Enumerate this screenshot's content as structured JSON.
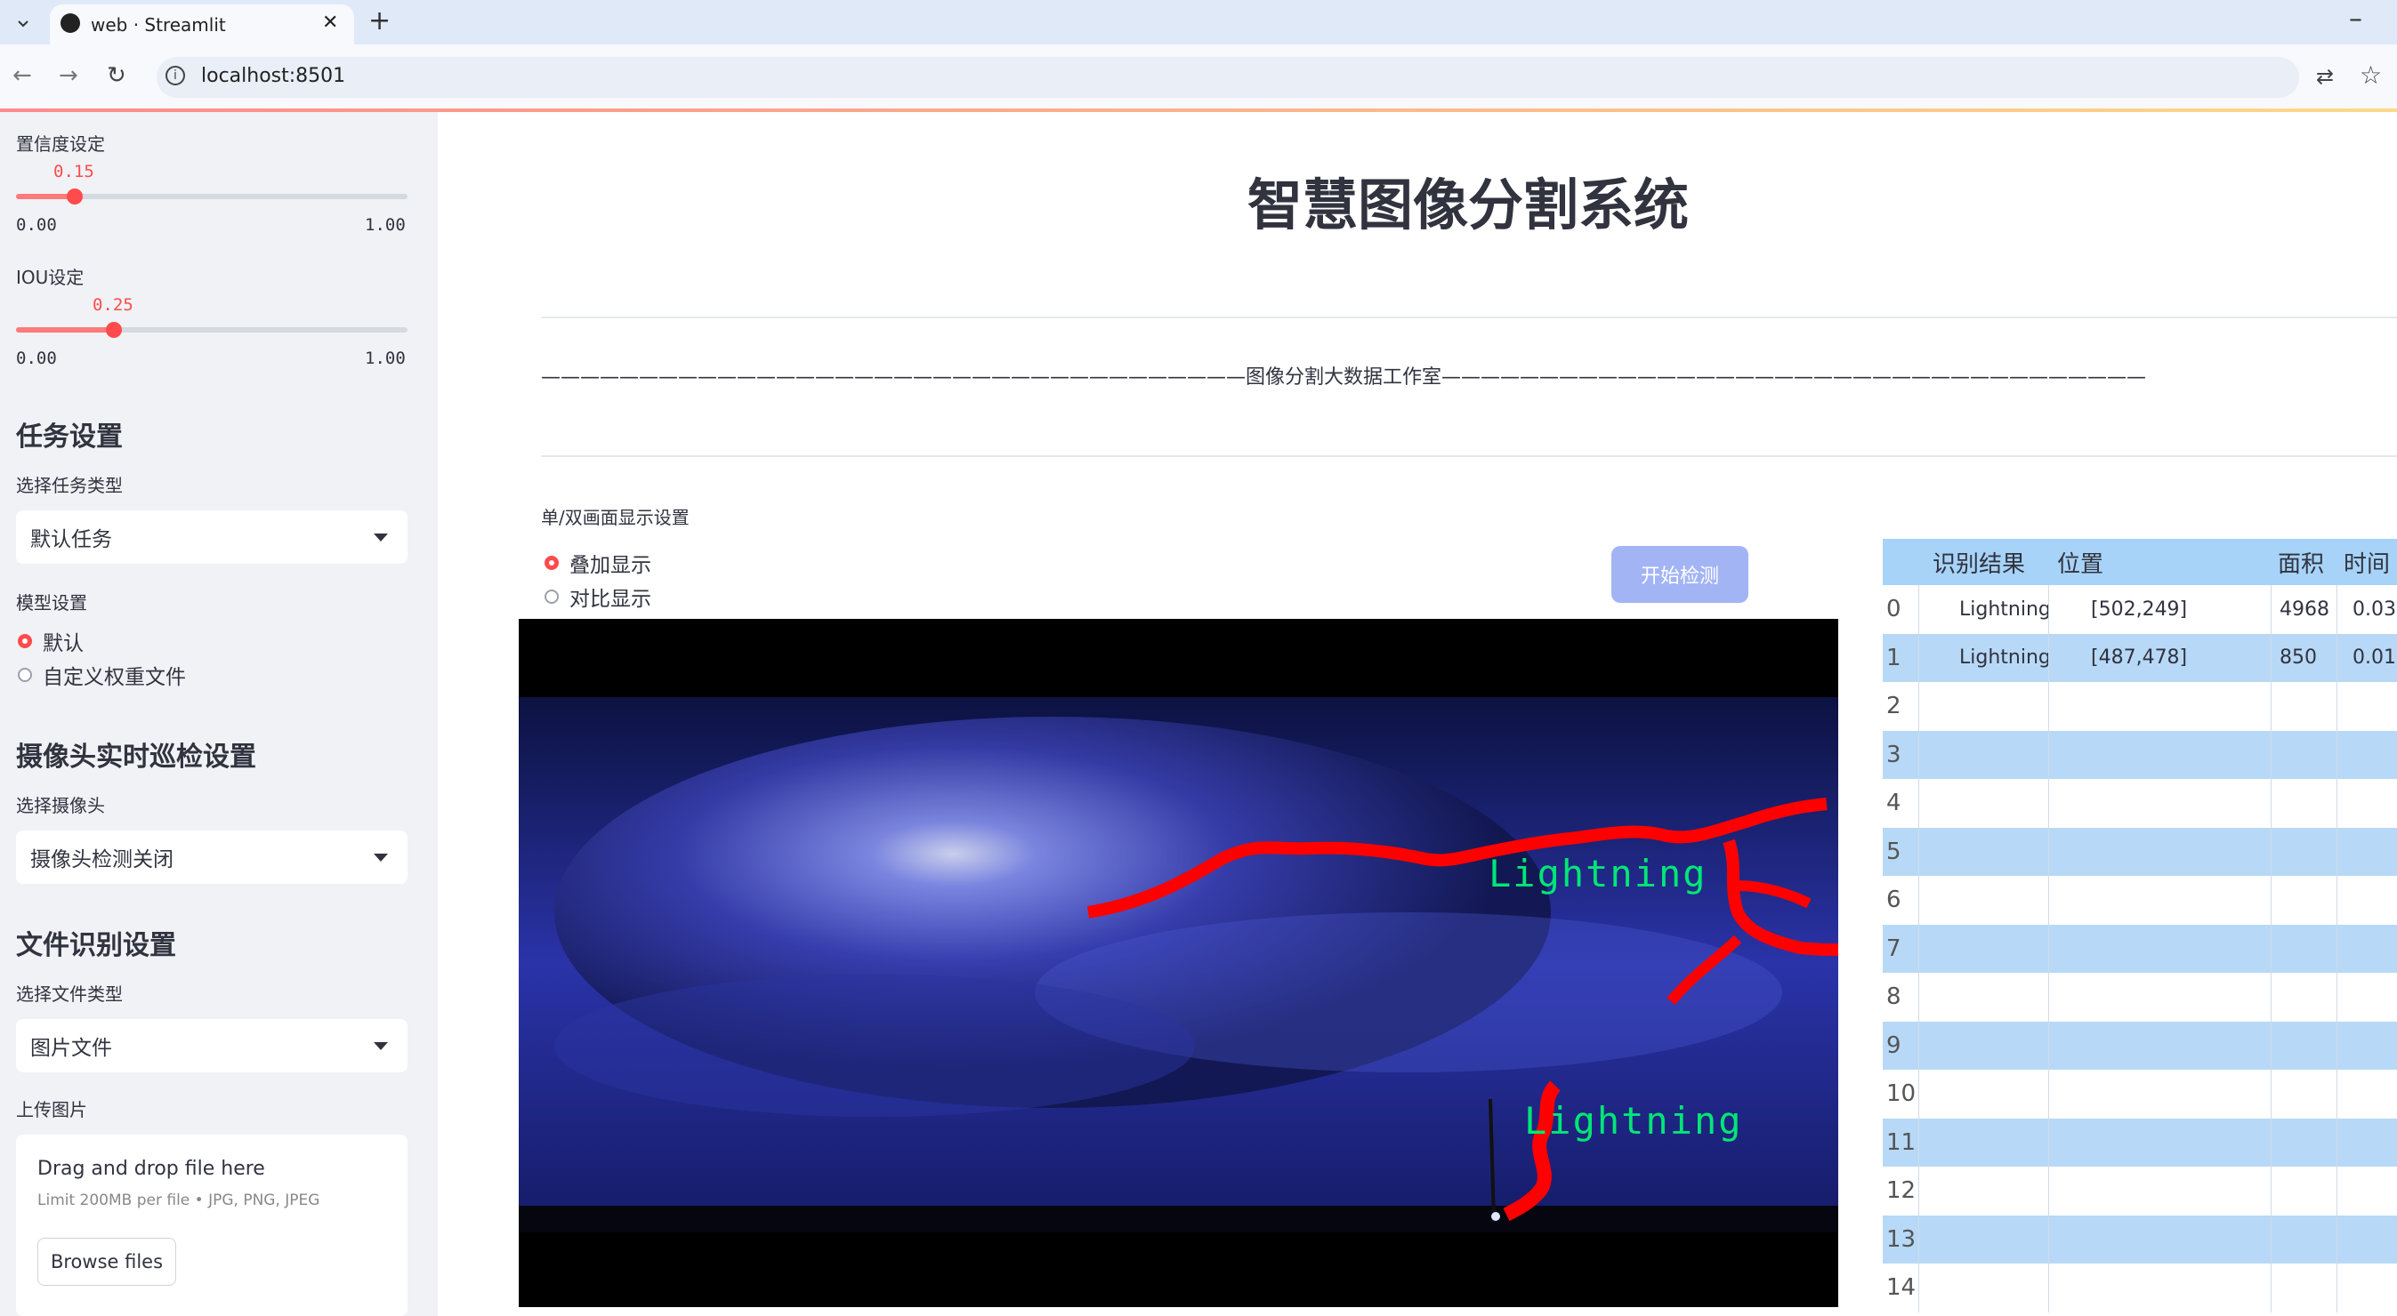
{
  "browser": {
    "tab_title": "web · Streamlit",
    "url": "localhost:8501",
    "new_tab": "+",
    "minimize": "–"
  },
  "sidebar": {
    "confidence": {
      "label": "置信度设定",
      "value": "0.15",
      "value_fraction": 0.15,
      "min": "0.00",
      "max": "1.00"
    },
    "iou": {
      "label": "IOU设定",
      "value": "0.25",
      "value_fraction": 0.25,
      "min": "0.00",
      "max": "1.00"
    },
    "task_header": "任务设置",
    "task_type_label": "选择任务类型",
    "task_type_value": "默认任务",
    "model_label": "模型设置",
    "model_options": [
      "默认",
      "自定义权重文件"
    ],
    "model_selected": "默认",
    "camera_header": "摄像头实时巡检设置",
    "camera_label": "选择摄像头",
    "camera_value": "摄像头检测关闭",
    "file_header": "文件识别设置",
    "file_type_label": "选择文件类型",
    "file_type_value": "图片文件",
    "upload_label": "上传图片",
    "upload_drop": "Drag and drop file here",
    "upload_limit": "Limit 200MB per file • JPG, PNG, JPEG",
    "upload_button": "Browse files"
  },
  "main": {
    "title": "智慧图像分割系统",
    "divider_text": "————————————————————————————————————图像分割大数据工作室————————————————————————————————————",
    "display_label": "单/双画面显示设置",
    "display_options": [
      "叠加显示",
      "对比显示"
    ],
    "display_selected": "叠加显示",
    "detect_button": "开始检测",
    "detections": [
      {
        "label": "Lightning"
      },
      {
        "label": "Lightning"
      }
    ]
  },
  "table": {
    "columns": [
      "识别结果",
      "位置",
      "面积",
      "时间"
    ],
    "rows": [
      {
        "idx": "0",
        "result": "Lightning",
        "pos": "[502,249]",
        "area": "4968",
        "time": "0.03"
      },
      {
        "idx": "1",
        "result": "Lightning",
        "pos": "[487,478]",
        "area": "850",
        "time": "0.01"
      },
      {
        "idx": "2"
      },
      {
        "idx": "3"
      },
      {
        "idx": "4"
      },
      {
        "idx": "5"
      },
      {
        "idx": "6"
      },
      {
        "idx": "7"
      },
      {
        "idx": "8"
      },
      {
        "idx": "9"
      },
      {
        "idx": "10"
      },
      {
        "idx": "11"
      },
      {
        "idx": "12"
      },
      {
        "idx": "13"
      },
      {
        "idx": "14"
      }
    ]
  },
  "colors": {
    "accent": "#ff4b4b",
    "sidebar_bg": "#f0f2f6",
    "table_header": "#a7d3f8",
    "detect_mask": "#ff0000",
    "detect_label": "#00e676"
  }
}
